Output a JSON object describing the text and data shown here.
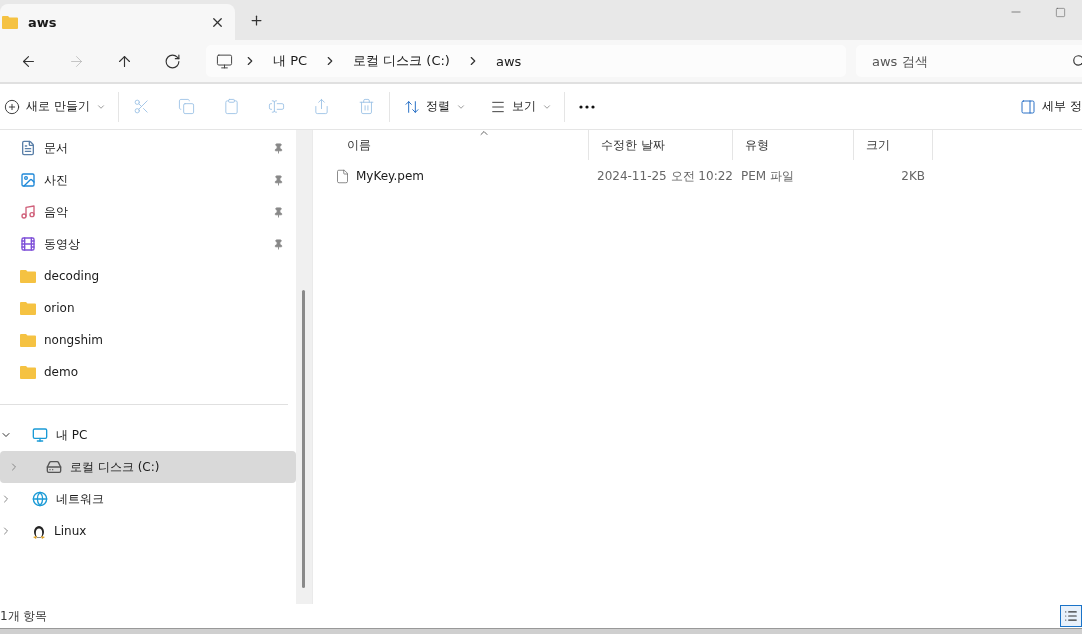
{
  "tab": {
    "title": "aws",
    "selected": true
  },
  "address": {
    "crumbs": [
      "내 PC",
      "로컬 디스크 (C:)",
      "aws"
    ]
  },
  "nav_buttons": [
    {
      "kind": "back",
      "disabled": false
    },
    {
      "kind": "forward",
      "disabled": true
    },
    {
      "kind": "up",
      "disabled": false
    },
    {
      "kind": "refresh",
      "disabled": false
    }
  ],
  "search": {
    "placeholder": "aws 검색"
  },
  "toolbar": {
    "new": "새로 만들기",
    "actions": [
      {
        "kind": "cut",
        "disabled": true
      },
      {
        "kind": "copy",
        "disabled": true
      },
      {
        "kind": "paste",
        "disabled": true
      },
      {
        "kind": "rename",
        "disabled": true
      },
      {
        "kind": "share",
        "disabled": true
      },
      {
        "kind": "delete",
        "disabled": true
      }
    ],
    "sort": "정렬",
    "view": "보기",
    "details": "세부 정"
  },
  "quick_access": [
    {
      "label": "문서",
      "kind": "documents",
      "pinned": true
    },
    {
      "label": "사진",
      "kind": "pictures",
      "pinned": true
    },
    {
      "label": "음악",
      "kind": "music",
      "pinned": true
    },
    {
      "label": "동영상",
      "kind": "videos",
      "pinned": true
    },
    {
      "label": "decoding",
      "kind": "folder",
      "pinned": false
    },
    {
      "label": "orion",
      "kind": "folder",
      "pinned": false
    },
    {
      "label": "nongshim",
      "kind": "folder",
      "pinned": false
    },
    {
      "label": "demo",
      "kind": "folder",
      "pinned": false
    }
  ],
  "tree": [
    {
      "label": "내 PC",
      "kind": "pc",
      "expanded": true,
      "selected": false,
      "children": [
        {
          "label": "로컬 디스크 (C:)",
          "kind": "drive",
          "expanded": false,
          "selected": true
        }
      ]
    },
    {
      "label": "네트워크",
      "kind": "network",
      "expanded": false,
      "selected": false
    },
    {
      "label": "Linux",
      "kind": "linux",
      "expanded": false,
      "selected": false
    }
  ],
  "table": {
    "columns": [
      "이름",
      "수정한 날짜",
      "유형",
      "크기"
    ],
    "rows": [
      {
        "name": "MyKey.pem",
        "modified": "2024-11-25 오전 10:22",
        "type": "PEM 파일",
        "size": "2KB"
      }
    ]
  },
  "status_bar": {
    "count": "1개 항목"
  }
}
